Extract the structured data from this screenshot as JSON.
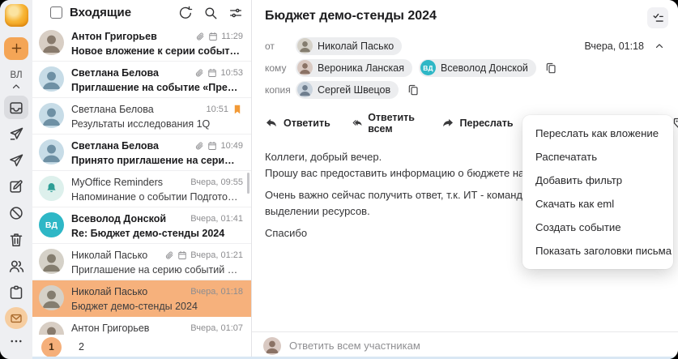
{
  "rail": {
    "user_initials": "ВЛ",
    "items": [
      "add",
      "inbox",
      "outbox",
      "sent",
      "drafts",
      "spam",
      "trash"
    ],
    "apps": [
      "contacts",
      "calendar",
      "mail",
      "more"
    ],
    "accent": "#F4A556"
  },
  "list": {
    "title": "Входящие",
    "selected_bg": "#F6B17C",
    "emails": [
      {
        "name": "Антон Григорьев",
        "subject": "Новое вложение к серии событий «Аналити…",
        "time": "11:29",
        "unread": true,
        "attach": true,
        "event": true,
        "avatar_style": "background:#D8CEC4;color:#887A6C"
      },
      {
        "name": "Светлана Белова",
        "subject": "Приглашение на событие «Предварительно…",
        "time": "10:53",
        "unread": true,
        "attach": true,
        "event": true,
        "avatar_style": "background:#C7DCE7;color:#6E90A4"
      },
      {
        "name": "Светлана Белова",
        "subject": "Результаты исследования 1Q",
        "time": "10:51",
        "unread": false,
        "flagged": true,
        "avatar_style": "background:#C7DCE7;color:#6E90A4"
      },
      {
        "name": "Светлана Белова",
        "subject": "Принято приглашение на серию событий «…",
        "time": "10:49",
        "unread": true,
        "attach": true,
        "event": true,
        "avatar_style": "background:#C7DCE7;color:#6E90A4"
      },
      {
        "name": "MyOffice Reminders",
        "subject": "Напоминание о событии Подготовить отчет…",
        "time": "Вчера, 09:55",
        "unread": false,
        "avatar_style": "background:#DDF0EC;color:#2E9E96"
      },
      {
        "name": "Всеволод Донской",
        "subject": "Re: Бюджет демо-стенды 2024",
        "time": "Вчера, 01:41",
        "unread": true,
        "initials": "ВД",
        "avatar_style": "background:#2EB7C6;color:#FFFFFF"
      },
      {
        "name": "Николай Пасько",
        "subject": "Приглашение на серию событий «Демо стен…",
        "time": "Вчера, 01:21",
        "unread": false,
        "attach": true,
        "event": true,
        "avatar_style": "background:#D5D1C8;color:#847D6F"
      },
      {
        "name": "Николай Пасько",
        "subject": "Бюджет демо-стенды 2024",
        "time": "Вчера, 01:18",
        "unread": false,
        "selected": true,
        "avatar_style": "background:#D5D1C8;color:#847D6F"
      },
      {
        "name": "Антон Григорьев",
        "subject": "",
        "time": "Вчера, 01:07",
        "unread": false,
        "avatar_style": "background:#D8CEC4;color:#887A6C"
      }
    ],
    "pagination": {
      "current": "1",
      "next": "2"
    }
  },
  "reader": {
    "title": "Бюджет демо-стенды 2024",
    "date": "Вчера, 01:18",
    "meta": {
      "from_label": "от",
      "to_label": "кому",
      "cc_label": "копия",
      "from": {
        "name": "Николай Пасько",
        "avatar_style": "background:#D5D1C8;color:#847D6F"
      },
      "to1": {
        "name": "Вероника Ланская",
        "avatar_style": "background:#D9C9C2;color:#8A7265"
      },
      "to2": {
        "name": "Всеволод Донской",
        "initials": "ВД",
        "avatar_style": "background:#2EB7C6;color:#FFFFFF"
      },
      "cc1": {
        "name": "Сергей Швецов",
        "avatar_style": "background:#C9D3DD;color:#6F7E8E"
      }
    },
    "toolbar": {
      "reply": "Ответить",
      "reply_all": "Ответить всем",
      "forward": "Переслать"
    },
    "body": {
      "p1l1": "Коллеги, добрый вечер.",
      "p1l2": "Прошу вас предоставить информацию о бюджете на наши демонстраци",
      "p2l1": "Очень важно сейчас получить ответ, т.к. ИТ - команда Всеволода, уже",
      "p2l2": "выделении ресурсов.",
      "p3": "Спасибо"
    },
    "reply_placeholder": "Ответить всем участникам"
  },
  "menu": {
    "items": [
      "Переслать как вложение",
      "Распечатать",
      "Добавить фильтр",
      "Скачать как eml",
      "Создать событие",
      "Показать заголовки письма"
    ]
  }
}
